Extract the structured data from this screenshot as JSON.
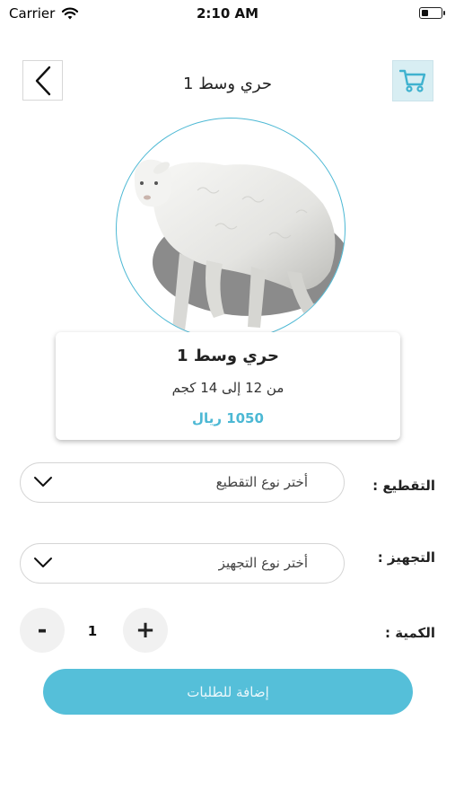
{
  "status_bar": {
    "carrier": "Carrier",
    "time": "2:10 AM",
    "battery_level": 0.35
  },
  "header": {
    "title": "حري وسط 1",
    "back_icon": "chevron-left-icon",
    "cart_icon": "cart-icon"
  },
  "product": {
    "image": "sheep-photo",
    "name": "حري وسط 1",
    "weight": "من 12 إلى 14 كجم",
    "price": "1050 ريال"
  },
  "cutting": {
    "label": "التقطيع :",
    "placeholder": "أختر نوع التقطيع"
  },
  "preparation": {
    "label": "التجهيز :",
    "placeholder": "أختر نوع التجهيز"
  },
  "quantity": {
    "label": "الكمية :",
    "value": "1",
    "decrement": "-",
    "increment": "+"
  },
  "submit": {
    "label": "إضافة للطلبات"
  },
  "colors": {
    "accent": "#4cb8d4",
    "button": "#55bfd9",
    "cart_bg": "#d8eef3"
  }
}
